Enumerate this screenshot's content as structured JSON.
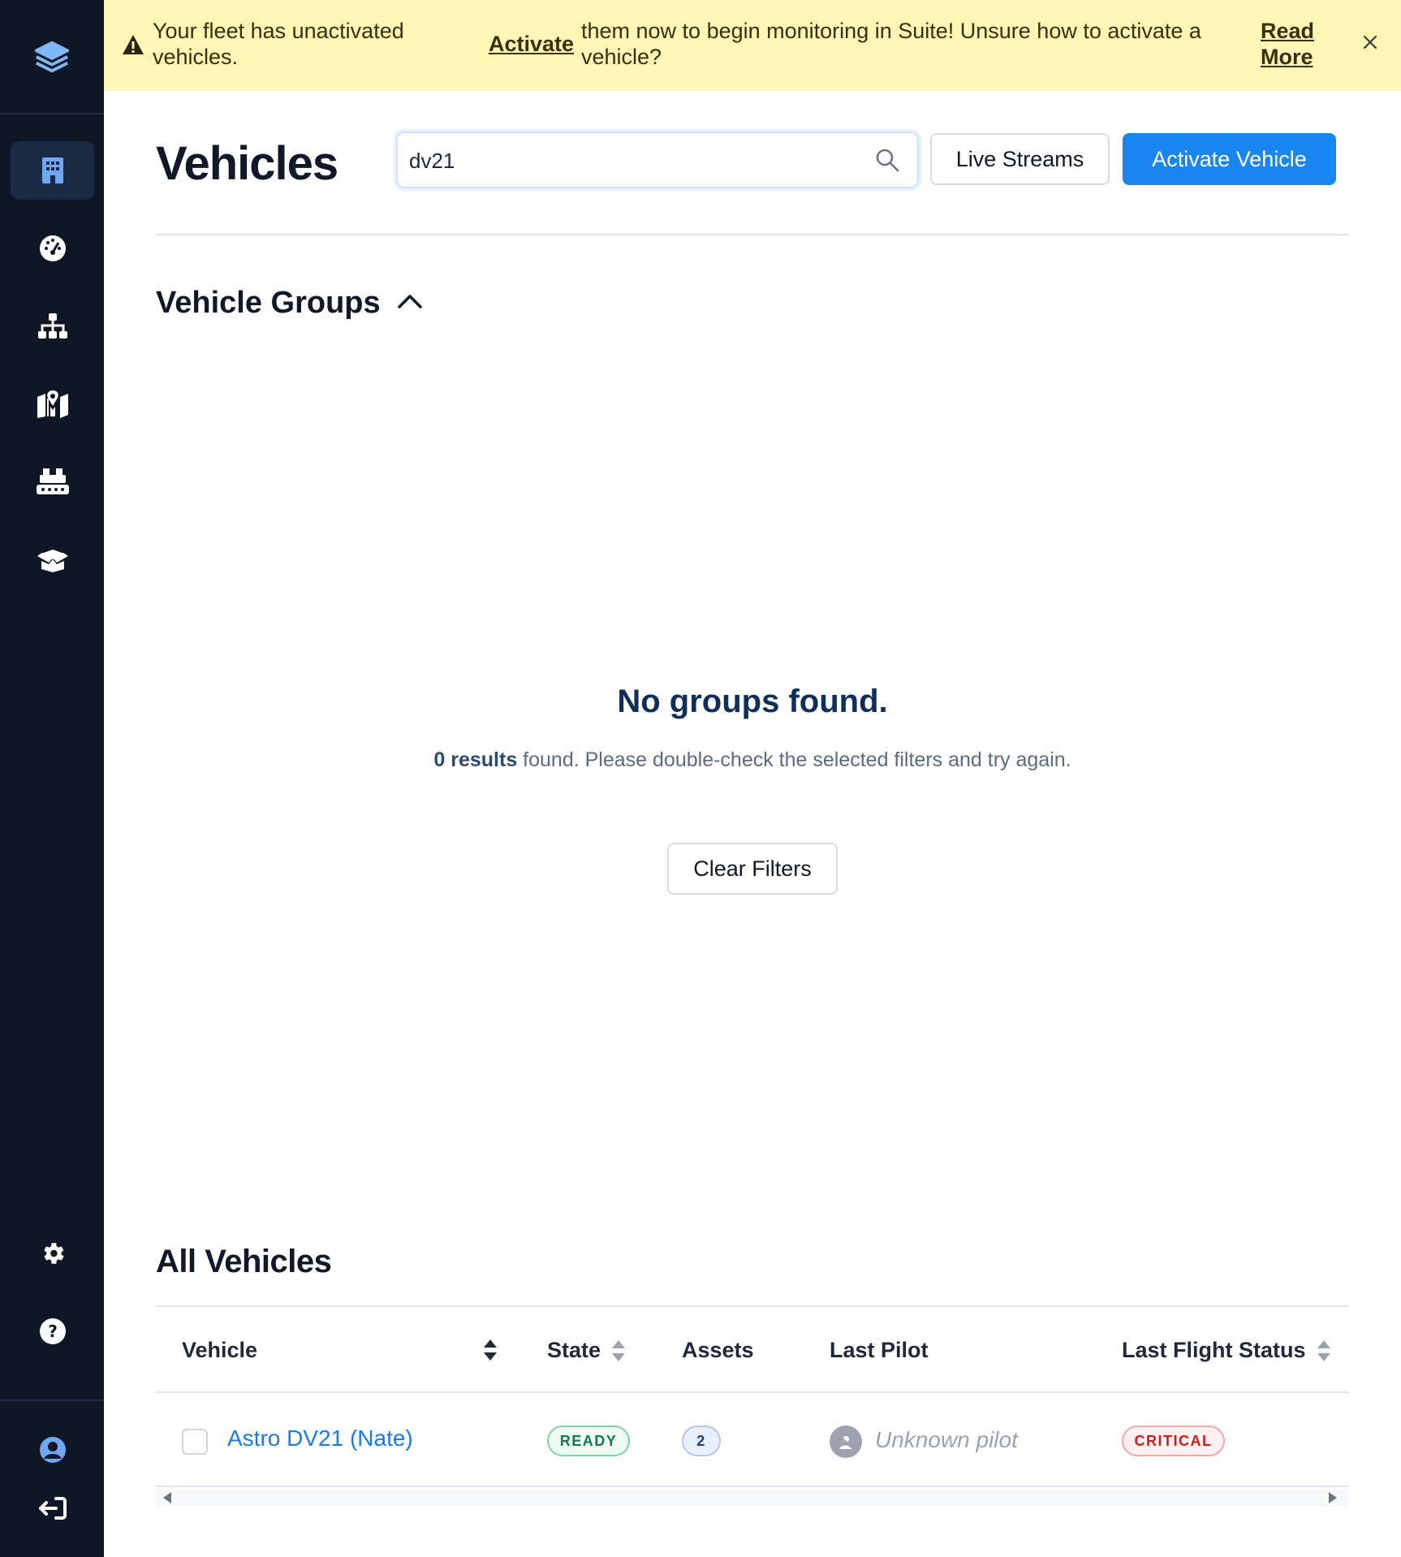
{
  "banner": {
    "text_before": "Your fleet has unactivated vehicles.",
    "activate_link": "Activate",
    "text_after": "them now to begin monitoring in Suite! Unsure how to activate a vehicle?",
    "read_more": "Read More"
  },
  "sidebar": {
    "items": [
      {
        "icon": "building-icon",
        "active": true
      },
      {
        "icon": "dashboard-gauge-icon",
        "active": false
      },
      {
        "icon": "hierarchy-icon",
        "active": false
      },
      {
        "icon": "map-location-icon",
        "active": false
      },
      {
        "icon": "dock-icon",
        "active": false
      },
      {
        "icon": "box-open-icon",
        "active": false
      }
    ],
    "bottom_items": [
      {
        "icon": "gear-icon"
      },
      {
        "icon": "help-icon"
      },
      {
        "icon": "user-icon"
      },
      {
        "icon": "sign-out-icon"
      }
    ]
  },
  "header": {
    "title": "Vehicles",
    "search_value": "dv21",
    "live_streams": "Live Streams",
    "activate_vehicle": "Activate Vehicle"
  },
  "groups": {
    "title": "Vehicle Groups",
    "empty_title": "No groups found.",
    "results_count": "0 results",
    "empty_message": " found. Please double-check the selected filters and try again.",
    "clear_filters": "Clear Filters"
  },
  "all_vehicles": {
    "title": "All Vehicles",
    "columns": {
      "vehicle": "Vehicle",
      "state": "State",
      "assets": "Assets",
      "last_pilot": "Last Pilot",
      "last_flight_status": "Last Flight Status"
    },
    "rows": [
      {
        "vehicle": "Astro DV21 (Nate)",
        "state": "READY",
        "assets": "2",
        "last_pilot": "Unknown pilot",
        "last_flight_status": "CRITICAL"
      }
    ]
  },
  "colors": {
    "sidebar_bg": "#0f1626",
    "banner_bg": "#fdf7b5",
    "primary": "#1a86f0",
    "status_dot": "#f5c518"
  }
}
